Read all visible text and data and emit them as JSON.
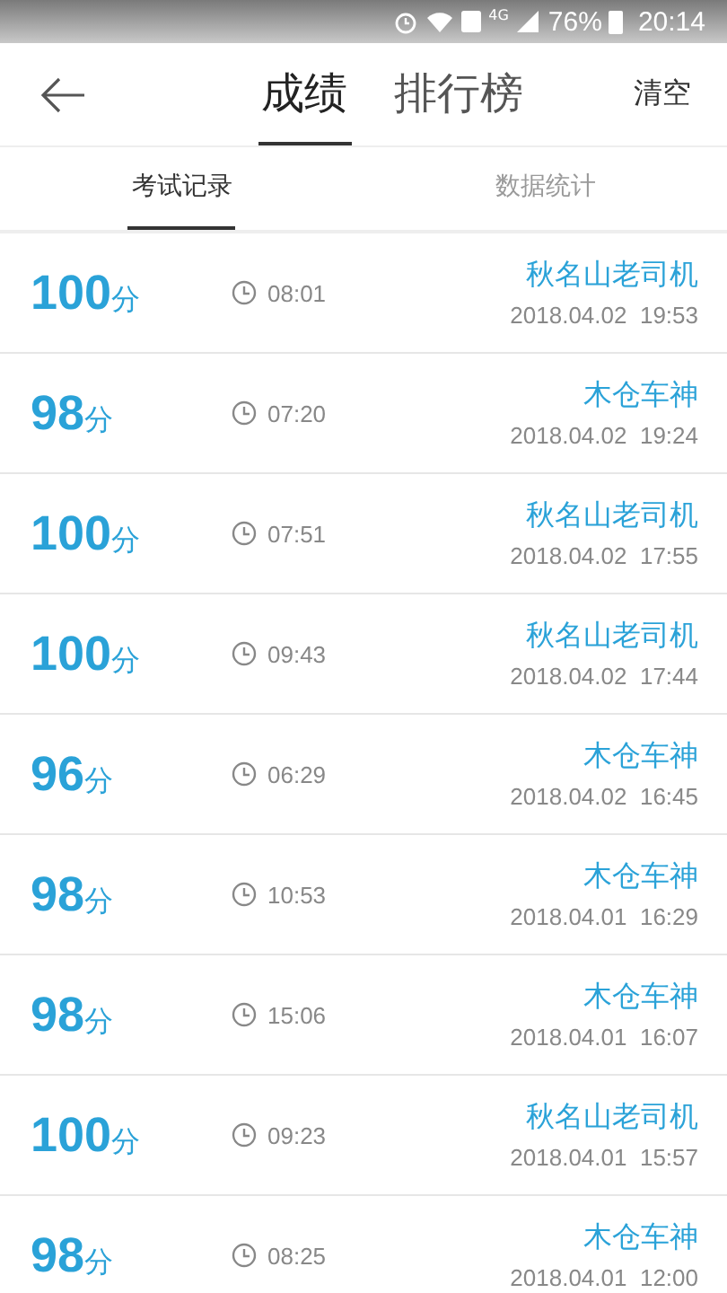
{
  "status_bar": {
    "network": "4G",
    "battery": "76%",
    "time": "20:14"
  },
  "header": {
    "tabs": [
      {
        "label": "成绩",
        "selected": true
      },
      {
        "label": "排行榜",
        "selected": false
      }
    ],
    "action": "清空"
  },
  "sub_tabs": [
    {
      "label": "考试记录",
      "selected": true
    },
    {
      "label": "数据统计",
      "selected": false
    }
  ],
  "records": [
    {
      "score": "100",
      "unit": "分",
      "duration": "08:01",
      "name": "秋名山老司机",
      "date": "2018.04.02  19:53"
    },
    {
      "score": "98",
      "unit": "分",
      "duration": "07:20",
      "name": "木仓车神",
      "date": "2018.04.02  19:24"
    },
    {
      "score": "100",
      "unit": "分",
      "duration": "07:51",
      "name": "秋名山老司机",
      "date": "2018.04.02  17:55"
    },
    {
      "score": "100",
      "unit": "分",
      "duration": "09:43",
      "name": "秋名山老司机",
      "date": "2018.04.02  17:44"
    },
    {
      "score": "96",
      "unit": "分",
      "duration": "06:29",
      "name": "木仓车神",
      "date": "2018.04.02  16:45"
    },
    {
      "score": "98",
      "unit": "分",
      "duration": "10:53",
      "name": "木仓车神",
      "date": "2018.04.01  16:29"
    },
    {
      "score": "98",
      "unit": "分",
      "duration": "15:06",
      "name": "木仓车神",
      "date": "2018.04.01  16:07"
    },
    {
      "score": "100",
      "unit": "分",
      "duration": "09:23",
      "name": "秋名山老司机",
      "date": "2018.04.01  15:57"
    },
    {
      "score": "98",
      "unit": "分",
      "duration": "08:25",
      "name": "木仓车神",
      "date": "2018.04.01  12:00"
    }
  ]
}
